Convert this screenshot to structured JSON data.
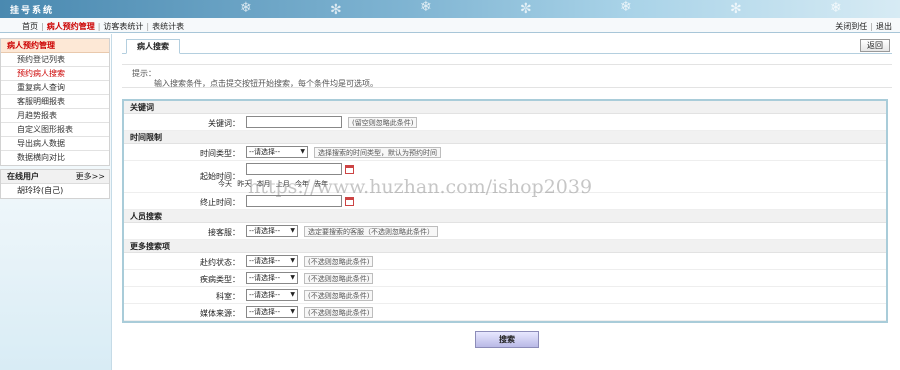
{
  "header": {
    "title": "挂号系统"
  },
  "nav": {
    "items": [
      "首页",
      "病人预约管理",
      "访客表统计",
      "表统计表"
    ],
    "right": [
      "关闭到任",
      "退出"
    ]
  },
  "sidebar": {
    "menu_title": "病人预约管理",
    "items": [
      "预约登记列表",
      "预约病人搜索",
      "重复病人查询",
      "客服明细报表",
      "月趋势报表",
      "自定义图形报表",
      "导出病人数据",
      "数据横向对比"
    ],
    "online_title": "在线用户",
    "online_more": "更多>>",
    "online_users": [
      "胡玲玲(自己)"
    ]
  },
  "main": {
    "tab": "病人搜索",
    "back_button": "返回",
    "hint_title": "提示：",
    "hint_text": "输入搜索条件，点击提交按钮开始搜索，每个条件均是可选项。",
    "search_button": "搜索"
  },
  "form": {
    "sec_keyword": "关键词",
    "keyword_label": "关键词：",
    "keyword_value": "",
    "keyword_note": "(留空则忽略此条件)",
    "sec_time": "时间限制",
    "time_type_label": "时间类型：",
    "time_type_value": "--请选择--",
    "time_type_note": "选择搜索的时间类型，默认为预约时间",
    "start_label": "起始时间：",
    "start_value": "",
    "quick_dates": [
      "今天",
      "昨天",
      "本月",
      "上月",
      "今年",
      "去年"
    ],
    "end_label": "终止时间：",
    "end_value": "",
    "sec_staff": "人员搜索",
    "staff_label": "接客服：",
    "staff_value": "--请选择--",
    "staff_note": "选定要搜索的客服（不选则忽略此条件）",
    "sec_more": "更多搜索项",
    "visit_label": "赴约状态：",
    "visit_value": "--请选择--",
    "visit_note": "(不选则忽略此条件)",
    "disease_label": "疾病类型：",
    "disease_value": "--请选择--",
    "disease_note": "(不选则忽略此条件)",
    "dept_label": "科室：",
    "dept_value": "--请选择--",
    "dept_note": "(不选则忽略此条件)",
    "media_label": "媒体来源：",
    "media_value": "--请选择--",
    "media_note": "(不选则忽略此条件)"
  },
  "watermark": "https://www.huzhan.com/ishop2039"
}
